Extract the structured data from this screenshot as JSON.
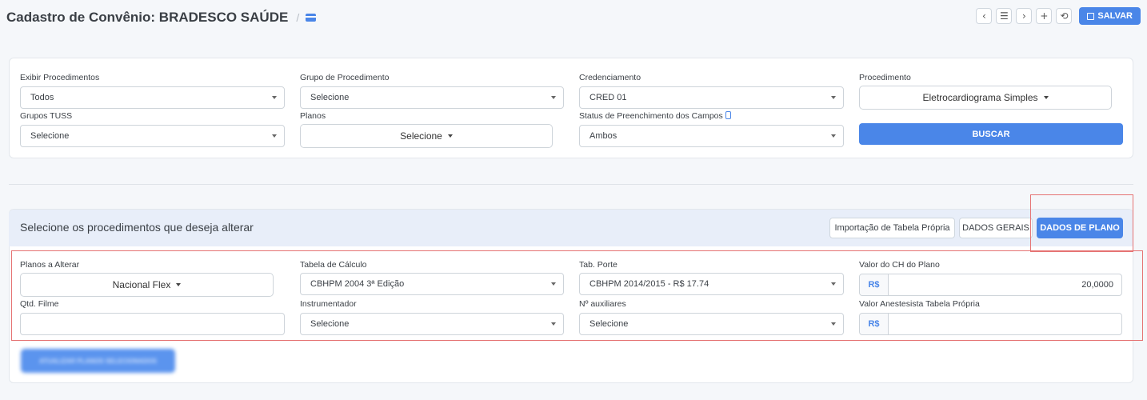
{
  "header": {
    "title": "Cadastro de Convênio: BRADESCO SAÚDE",
    "separator": "/",
    "toolbar": {
      "prev": "‹",
      "list": "☰",
      "next": "›",
      "add": "+",
      "history": "⟲",
      "save_label": "SALVAR"
    }
  },
  "filters": {
    "exibir": {
      "label": "Exibir Procedimentos",
      "value": "Todos"
    },
    "grupo_proc": {
      "label": "Grupo de Procedimento",
      "value": "Selecione"
    },
    "credenciamento": {
      "label": "Credenciamento",
      "value": "CRED 01"
    },
    "procedimento": {
      "label": "Procedimento",
      "value": "Eletrocardiograma Simples"
    },
    "grupos_tuss": {
      "label": "Grupos TUSS",
      "value": "Selecione"
    },
    "planos": {
      "label": "Planos",
      "value": "Selecione"
    },
    "status": {
      "label": "Status de Preenchimento dos Campos",
      "value": "Ambos"
    },
    "search_label": "BUSCAR"
  },
  "procedures": {
    "title": "Selecione os procedimentos que deseja alterar",
    "buttons": {
      "import": "Importação de Tabela Própria",
      "general": "DADOS GERAIS",
      "plan": "DADOS DE PLANO"
    },
    "fields": {
      "planos_alterar": {
        "label": "Planos a Alterar",
        "value": "Nacional Flex"
      },
      "tabela_calculo": {
        "label": "Tabela de Cálculo",
        "value": "CBHPM 2004 3ª Edição"
      },
      "tab_porte": {
        "label": "Tab. Porte",
        "value": "CBHPM 2014/2015 - R$ 17.74"
      },
      "valor_ch": {
        "label": "Valor do CH do Plano",
        "prefix": "R$",
        "value": "20,0000"
      },
      "qtd_filme": {
        "label": "Qtd. Filme",
        "value": ""
      },
      "instrumentador": {
        "label": "Instrumentador",
        "value": "Selecione"
      },
      "auxiliares": {
        "label": "Nº auxiliares",
        "value": "Selecione"
      },
      "valor_anest": {
        "label": "Valor Anestesista Tabela Própria",
        "prefix": "R$",
        "value": ""
      }
    },
    "apply_label": "ATUALIZAR PLANOS SELECIONADOS"
  },
  "colors": {
    "accent": "#4a86e8",
    "highlight": "#e57373"
  }
}
